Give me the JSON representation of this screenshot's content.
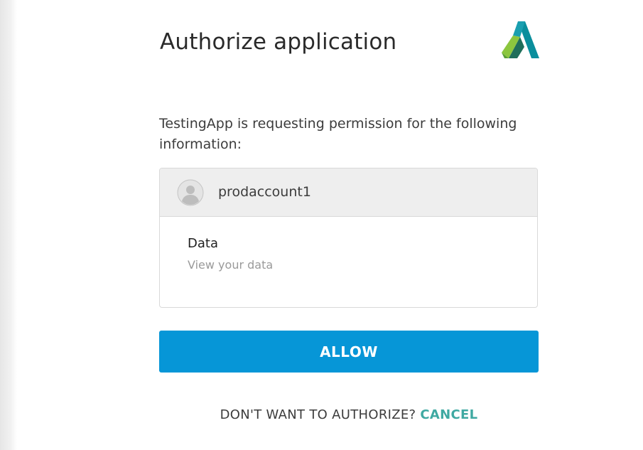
{
  "header": {
    "title": "Authorize application",
    "logo_icon": "autodesk-logo-icon"
  },
  "request": {
    "message": "TestingApp is requesting permission for the following information:"
  },
  "account": {
    "avatar_icon": "user-avatar-icon",
    "name": "prodaccount1"
  },
  "permission": {
    "title": "Data",
    "description": "View your data"
  },
  "actions": {
    "allow_label": "ALLOW",
    "decline_prompt": "DON'T WANT TO AUTHORIZE?",
    "cancel_label": "CANCEL"
  },
  "colors": {
    "primary": "#0696d7",
    "cancel_link": "#3fa9a2",
    "card_header_bg": "#eeeeee"
  }
}
